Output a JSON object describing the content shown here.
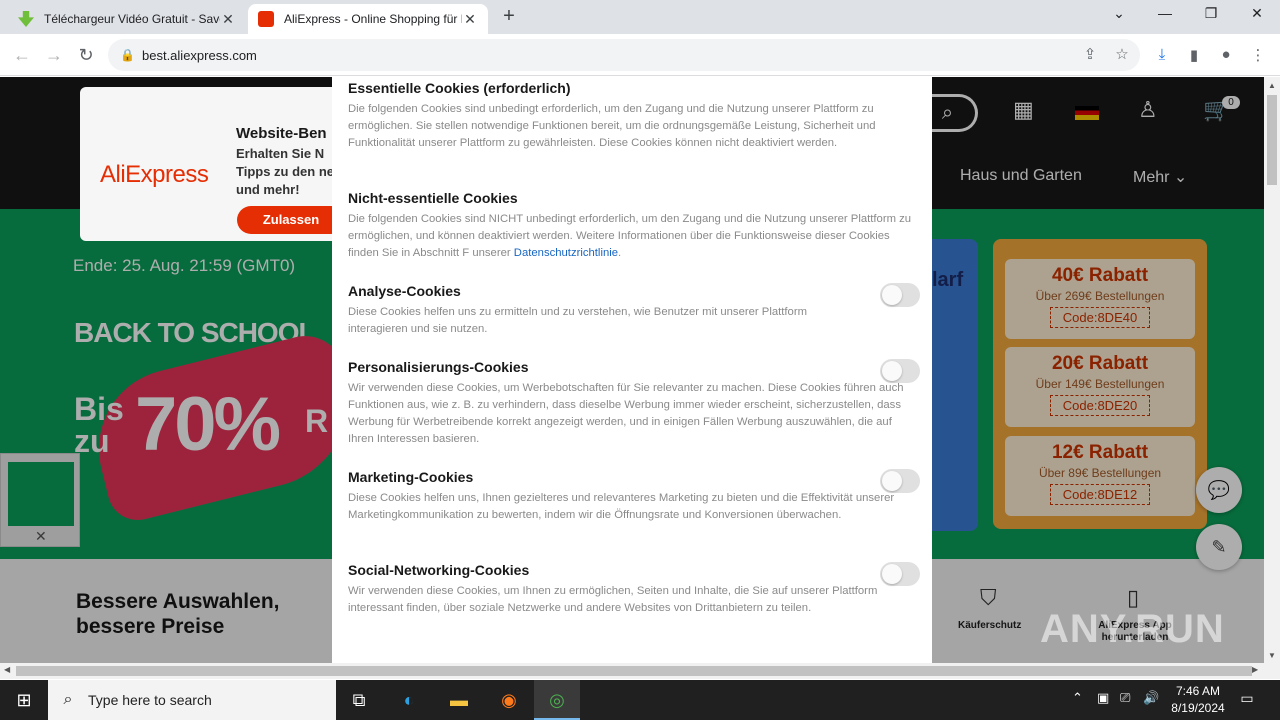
{
  "browser": {
    "tabs": [
      {
        "title": "Téléchargeur Vidéo Gratuit - Save",
        "favicon_color": "#6fbf3a",
        "active": false
      },
      {
        "title": "AliExpress - Online Shopping für P",
        "favicon_color": "#e62e04",
        "active": true
      }
    ],
    "new_tab_icon": "+",
    "window_controls": {
      "dropdown": "⌄",
      "minimize": "—",
      "restore": "❐",
      "close": "✕"
    },
    "url": "best.aliexpress.com",
    "nav": {
      "back": "←",
      "forward": "→",
      "reload": "↻"
    }
  },
  "page": {
    "login_card": {
      "logo": "AliExpress",
      "title": "Website-Ben",
      "text_lines": [
        "Erhalten Sie N",
        "Tipps zu den ne",
        "und mehr!"
      ],
      "button": "Zulassen"
    },
    "header": {
      "cart_count": "0",
      "nav_items": [
        "Haus und Garten",
        "Mehr ⌄"
      ]
    },
    "promo": {
      "end_date": "Ende: 25. Aug. 21:59 (GMT0)",
      "headline": "BACK TO SCHOOL",
      "bis_zu": "Bis zu",
      "percent": "70%",
      "percent_suffix": "R",
      "blue_panel_text": "larf",
      "coupons": [
        {
          "amount": "40€ Rabatt",
          "condition": "Über 269€ Bestellungen",
          "code": "Code:8DE40"
        },
        {
          "amount": "20€ Rabatt",
          "condition": "Über 149€ Bestellungen",
          "code": "Code:8DE20"
        },
        {
          "amount": "12€ Rabatt",
          "condition": "Über 89€ Bestellungen",
          "code": "Code:8DE12"
        }
      ]
    },
    "bottom": {
      "headline": "Bessere Auswahlen, bessere Preise",
      "features": [
        {
          "label": "Käuferschutz",
          "icon": "shield-check-icon"
        },
        {
          "label": "AliExpress App herunterladen",
          "icon": "phone-icon"
        }
      ]
    }
  },
  "cookie_modal": {
    "sections": [
      {
        "title": "Essentielle Cookies (erforderlich)",
        "text": "Die folgenden Cookies sind unbedingt erforderlich, um den Zugang und die Nutzung unserer Plattform zu ermöglichen. Sie stellen notwendige Funktionen bereit, um die ordnungsgemäße Leistung, Sicherheit und Funktionalität unserer Plattform zu gewährleisten. Diese Cookies können nicht deaktiviert werden.",
        "toggle": false
      },
      {
        "title": "Nicht-essentielle Cookies",
        "text": "Die folgenden Cookies sind NICHT unbedingt erforderlich, um den Zugang und die Nutzung unserer Plattform zu ermöglichen, und können deaktiviert werden. Weitere Informationen über die Funktionsweise dieser Cookies finden Sie in Abschnitt F unserer",
        "link": "Datenschutzrichtlinie",
        "toggle": false
      },
      {
        "title": "Analyse-Cookies",
        "text": "Diese Cookies helfen uns zu ermitteln und zu verstehen, wie Benutzer mit unserer Plattform interagieren und sie nutzen.",
        "toggle": true,
        "enabled": false
      },
      {
        "title": "Personalisierungs-Cookies",
        "text": "Wir verwenden diese Cookies, um Werbebotschaften für Sie relevanter zu machen. Diese Cookies führen auch Funktionen aus, wie z. B. zu verhindern, dass dieselbe Werbung immer wieder erscheint, sicherzustellen, dass Werbung für Werbetreibende korrekt angezeigt werden, und in einigen Fällen Werbung auszuwählen, die auf Ihren Interessen basieren.",
        "toggle": true,
        "enabled": false
      },
      {
        "title": "Marketing-Cookies",
        "text": "Diese Cookies helfen uns, Ihnen gezielteres und relevanteres Marketing zu bieten und die Effektivität unserer Marketingkommunikation zu bewerten, indem wir die Öffnungsrate und Konversionen überwachen.",
        "toggle": true,
        "enabled": false
      },
      {
        "title": "Social-Networking-Cookies",
        "text": "Wir verwenden diese Cookies, um Ihnen zu ermöglichen, Seiten und Inhalte, die Sie auf unserer Plattform interessant finden, über soziale Netzwerke und andere Websites von Drittanbietern zu teilen.",
        "toggle": true,
        "enabled": false
      }
    ]
  },
  "watermark": "ANY.RUN",
  "taskbar": {
    "search_placeholder": "Type here to search",
    "time": "7:46 AM",
    "date": "8/19/2024"
  },
  "colors": {
    "aliexpress_red": "#e62e04",
    "promo_green": "#0aa05a",
    "header_dark": "#191919",
    "link_blue": "#1766c2"
  }
}
